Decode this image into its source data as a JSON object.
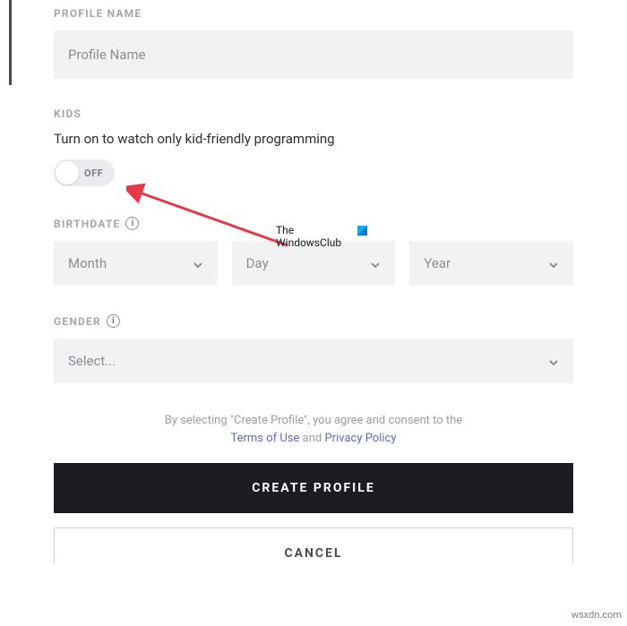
{
  "profileName": {
    "label": "PROFILE NAME",
    "placeholder": "Profile Name"
  },
  "kids": {
    "label": "KIDS",
    "description": "Turn on to watch only kid-friendly programming",
    "toggleState": "OFF"
  },
  "birthdate": {
    "label": "BIRTHDATE",
    "month": "Month",
    "day": "Day",
    "year": "Year"
  },
  "gender": {
    "label": "GENDER",
    "selected": "Select..."
  },
  "disclaimer": {
    "prefix": "By selecting \"Create Profile\", you agree and consent to the",
    "terms": "Terms of Use",
    "and": " and ",
    "privacy": "Privacy Policy"
  },
  "buttons": {
    "create": "CREATE PROFILE",
    "cancel": "CANCEL"
  },
  "watermark": {
    "line1": "The",
    "line2": "WindowsClub",
    "site": "wsxdn.com"
  }
}
